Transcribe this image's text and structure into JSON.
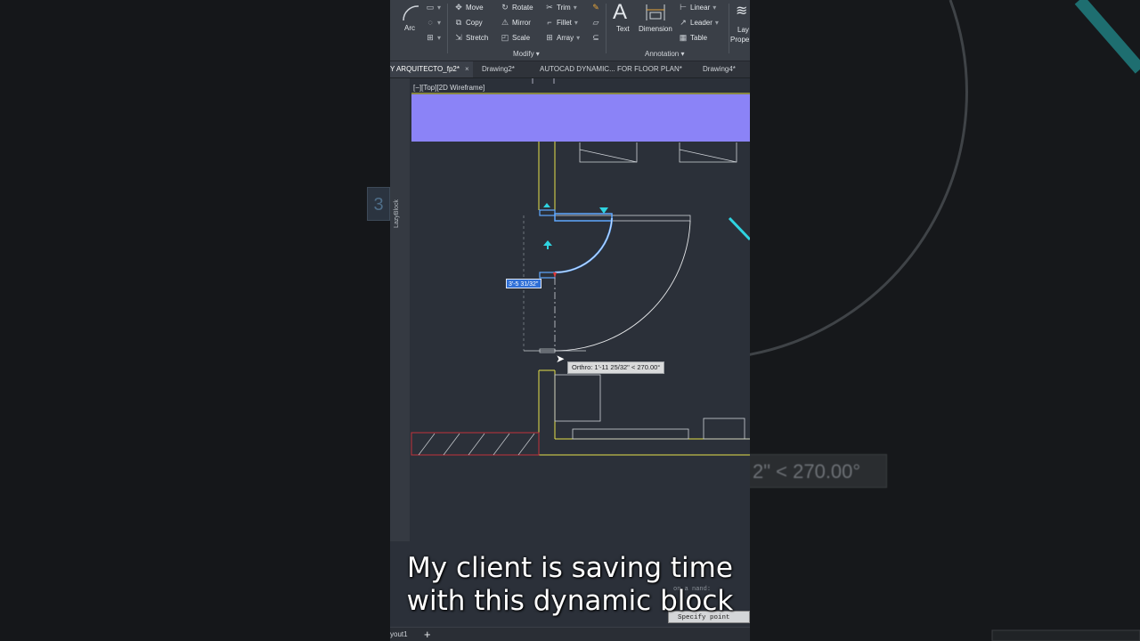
{
  "ribbon": {
    "draw": {
      "arc_label": "Arc"
    },
    "modify": {
      "move": "Move",
      "rotate": "Rotate",
      "trim": "Trim",
      "copy": "Copy",
      "mirror": "Mirror",
      "fillet": "Fillet",
      "stretch": "Stretch",
      "scale": "Scale",
      "array": "Array",
      "group_label": "Modify"
    },
    "annotation": {
      "text": "Text",
      "dimension": "Dimension",
      "linear": "Linear",
      "leader": "Leader",
      "table": "Table",
      "group_label": "Annotation"
    },
    "layers": {
      "label_top": "Lay",
      "label_bottom": "Prope"
    }
  },
  "tabs": [
    {
      "label": "Y ARQUITECTO_fp2*",
      "active": true
    },
    {
      "label": "Drawing2*"
    },
    {
      "label": "AUTOCAD DYNAMIC... FOR FLOOR PLAN*"
    },
    {
      "label": "Drawing4*"
    }
  ],
  "tab_close_glyph": "×",
  "viewport": {
    "label": "[−][Top][2D Wireframe]",
    "side_palette": "LazyBlock"
  },
  "dynamic_input": {
    "value": "3'-5 31/32\""
  },
  "ortho_tooltip": "Orthro: 1'-11 25/32\" < 270.00°",
  "background": {
    "ortho_fragment": "2\" < 270.00°",
    "side_tag": "3"
  },
  "command": {
    "prompt": "Specify point",
    "hint": "on a",
    "prefix": "nand:"
  },
  "layout_tab": "yout1",
  "add_layout_glyph": "+",
  "caption": {
    "line1": "My client is saving time",
    "line2": "with this dynamic block"
  },
  "colors": {
    "wall_yellow": "#e5e14a",
    "selection_blue": "#5fa8ff",
    "highlight_purple": "#8b83f7",
    "hatch_red": "#c0323a",
    "cyan_accent": "#2fd3e0"
  },
  "icons": [
    "arc-icon",
    "rectangle-icon",
    "circle-icon",
    "move-icon",
    "rotate-icon",
    "trim-icon",
    "copy-icon",
    "mirror-icon",
    "fillet-icon",
    "stretch-icon",
    "scale-icon",
    "array-icon",
    "text-icon",
    "dimension-icon",
    "linear-icon",
    "leader-icon",
    "table-icon",
    "cursor-icon"
  ]
}
